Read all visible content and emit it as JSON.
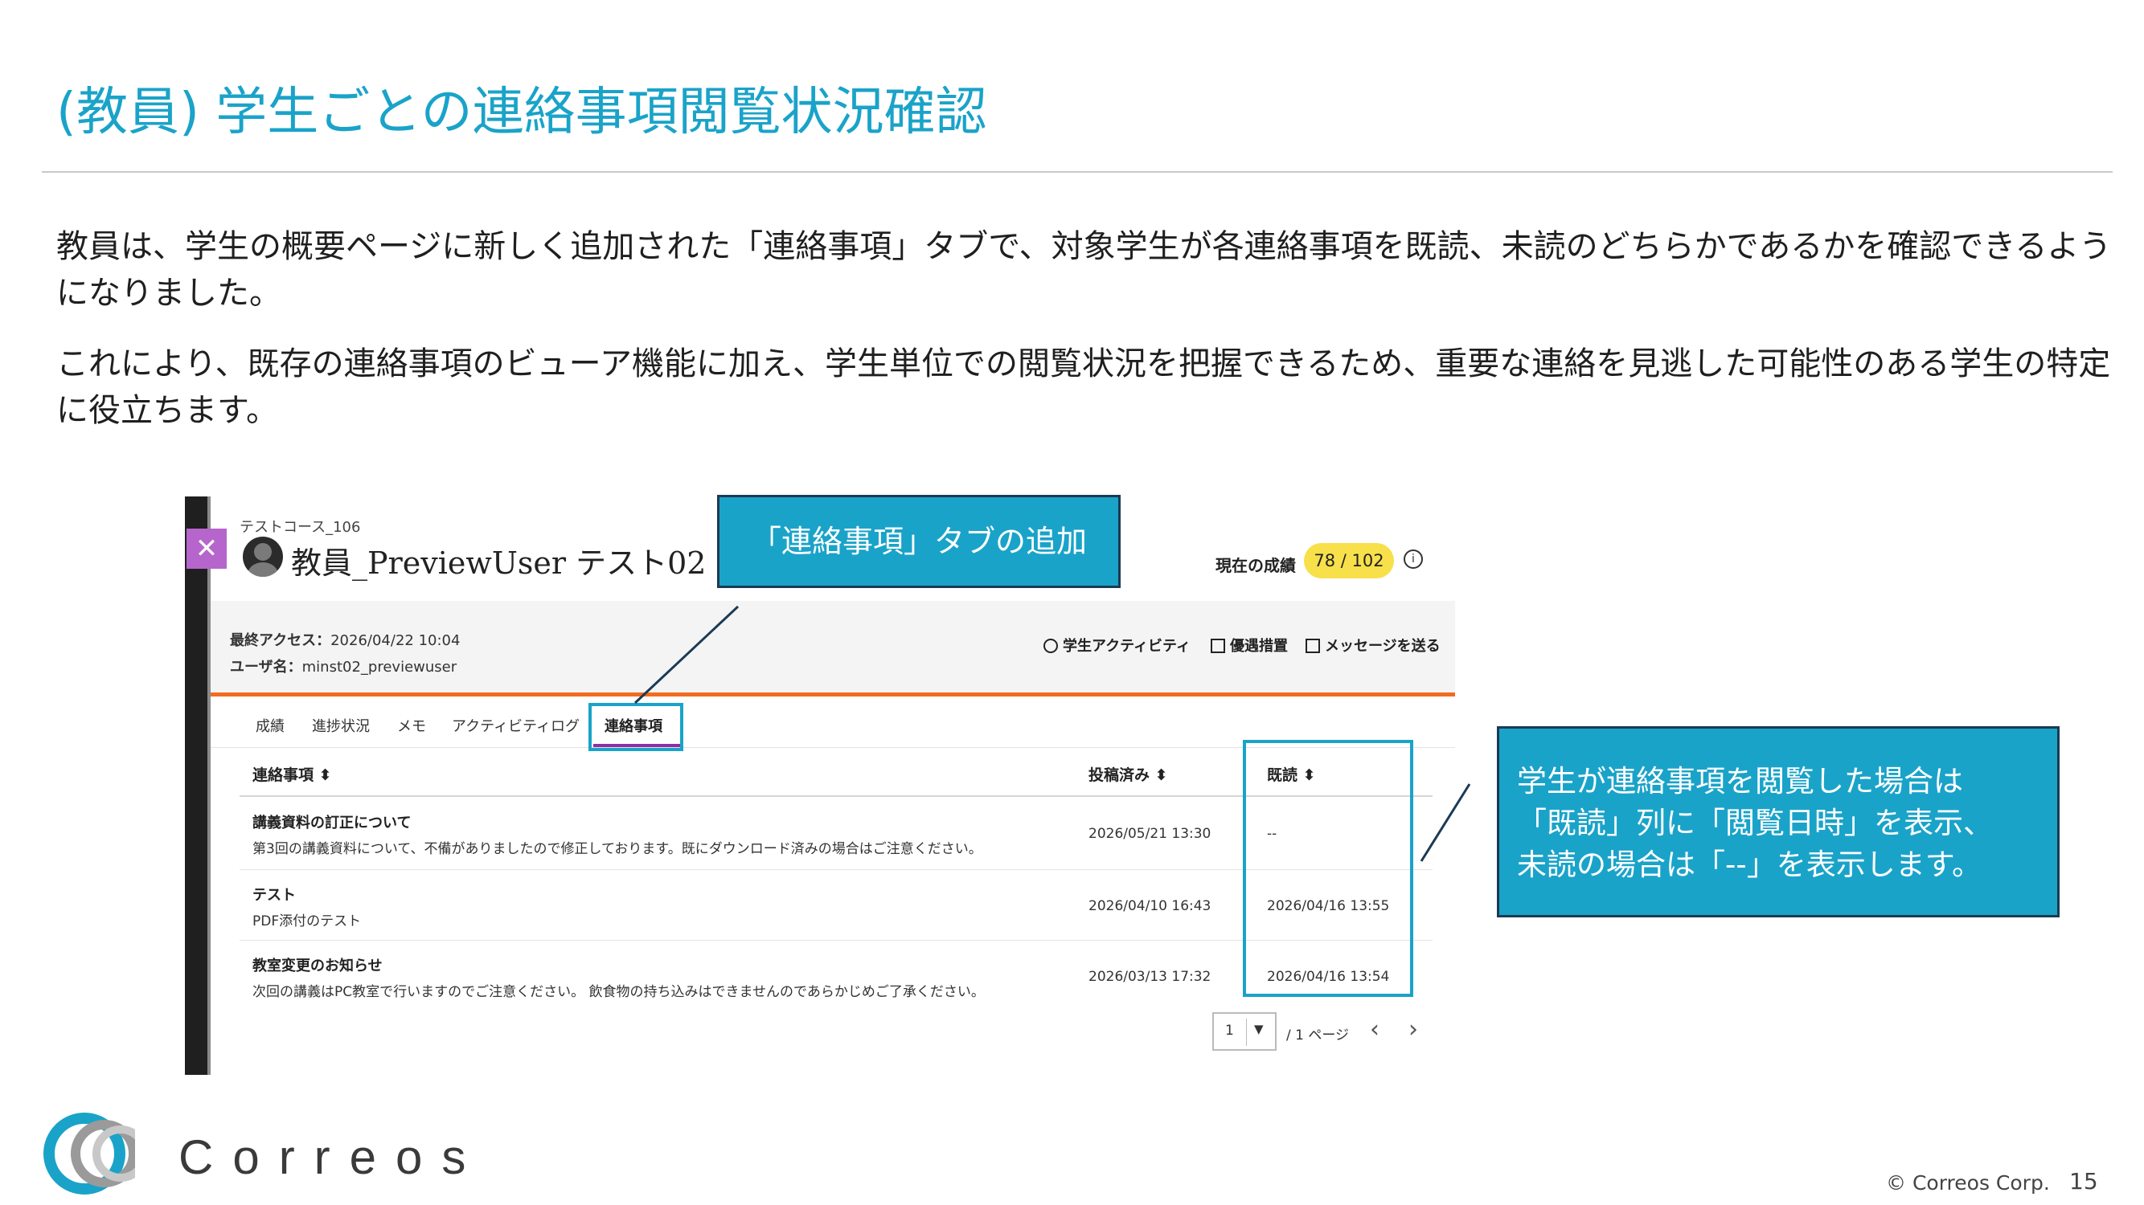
{
  "slide": {
    "title": "(教員) 学生ごとの連絡事項閲覧状況確認",
    "paragraph1": "教員は、学生の概要ページに新しく追加された「連絡事項」タブで、対象学生が各連絡事項を既読、未読のどちらかであるかを確認できるようになりました。",
    "paragraph2": "これにより、既存の連絡事項のビューア機能に加え、学生単位での閲覧状況を把握できるため、重要な連絡を見逃した可能性のある学生の特定に役立ちます。",
    "accent_color": "#1aa3c9"
  },
  "screenshot": {
    "course": "テストコース_106",
    "user_name": "教員_PreviewUser テスト02",
    "grade_label": "現在の成績",
    "grade_value": "78 / 102",
    "last_access_label": "最終アクセス：",
    "last_access_value": "2026/04/22 10:04",
    "username_label": "ユーザ名：",
    "username_value": "minst02_previewuser",
    "actions": [
      "学生アクティビティ",
      "優遇措置",
      "メッセージを送る"
    ],
    "tabs": [
      "成績",
      "進捗状況",
      "メモ",
      "アクティビティログ",
      "連絡事項"
    ],
    "active_tab": "連絡事項",
    "columns": [
      "連絡事項 ⬍",
      "投稿済み ⬍",
      "既読 ⬍"
    ],
    "rows": [
      {
        "title": "講義資料の訂正について",
        "desc": "第3回の講義資料について、不備がありましたので修正しております。既にダウンロード済みの場合はご注意ください。",
        "posted": "2026/05/21 13:30",
        "read": "--"
      },
      {
        "title": "テスト",
        "desc": "PDF添付のテスト",
        "posted": "2026/04/10 16:43",
        "read": "2026/04/16 13:55"
      },
      {
        "title": "教室変更のお知らせ",
        "desc": "次回の講義はPC教室で行いますのでご注意ください。 飲食物の持ち込みはできませんのであらかじめご了承ください。",
        "posted": "2026/03/13 17:32",
        "read": "2026/04/16 13:54"
      }
    ],
    "pager": {
      "page": "1",
      "total": "/ 1 ページ"
    },
    "orange": "#f26b1f",
    "grade_color": "#f7e04a"
  },
  "callouts": {
    "tab_added": "「連絡事項」タブの追加",
    "read_info": [
      "学生が連絡事項を閲覧した場合は",
      "「既読」列に「閲覧日時」を表示、",
      "未読の場合は「--」を表示します。"
    ]
  },
  "footer": {
    "brand": "Correos",
    "copyright": "© Correos Corp.",
    "page": "15"
  }
}
